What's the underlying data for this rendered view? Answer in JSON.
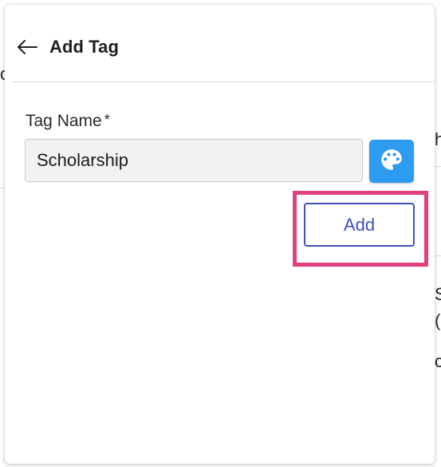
{
  "background": {
    "fragments": [
      "c",
      "h",
      "S",
      "(",
      "c"
    ]
  },
  "dialog": {
    "title": "Add Tag",
    "back_icon": "arrow-left-icon",
    "field": {
      "label": "Tag Name",
      "required_mark": "*",
      "value": "Scholarship"
    },
    "color_picker_icon": "palette-icon",
    "add_label": "Add",
    "colors": {
      "accent": "#3f51b5",
      "color_button": "#2d9bf0",
      "highlight": "#e0407e",
      "input_bg": "#f2f2f2"
    }
  }
}
